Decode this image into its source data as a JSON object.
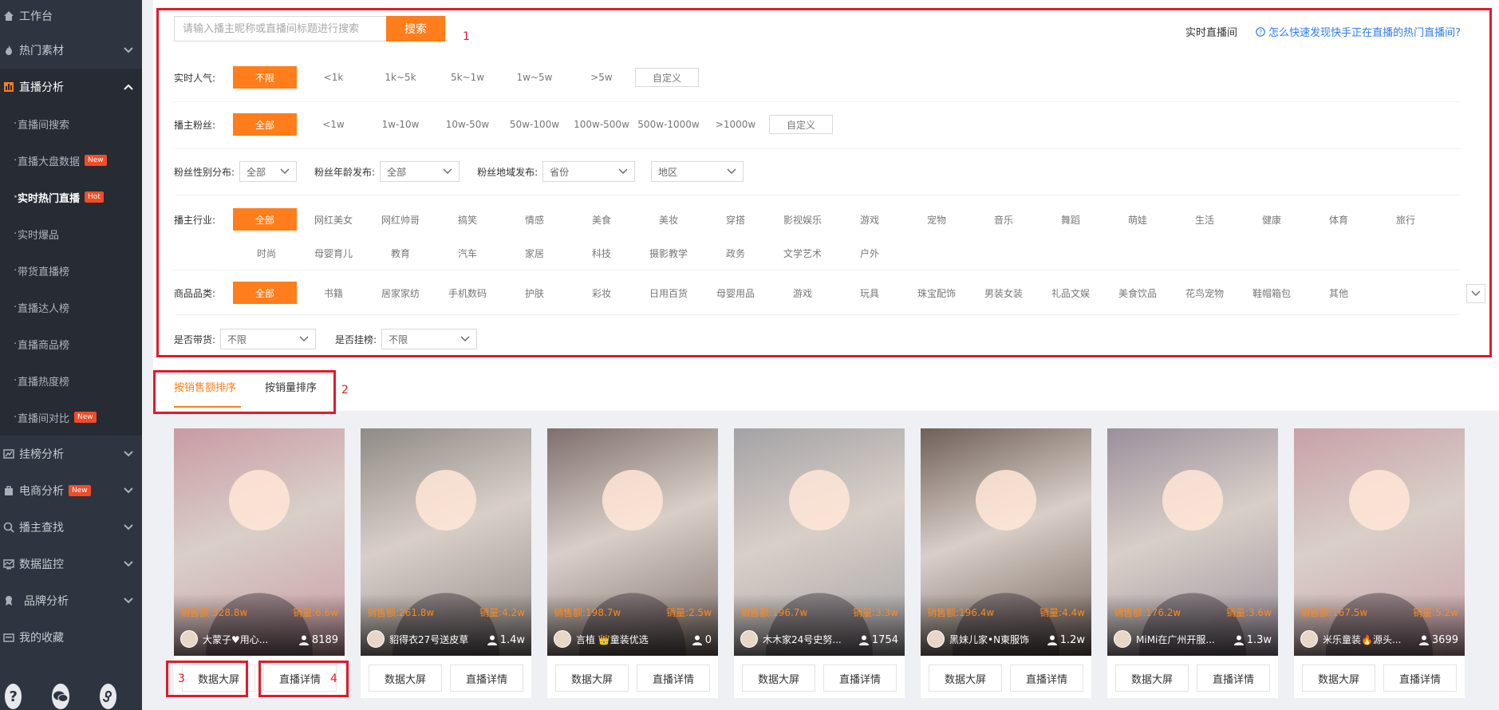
{
  "sidebar": {
    "workbench": "工作台",
    "hot_material": "热门素材",
    "live_analysis": "直播分析",
    "sub_items": [
      {
        "label": "直播间搜索",
        "badge": ""
      },
      {
        "label": "直播大盘数据",
        "badge": "New"
      },
      {
        "label": "实时热门直播",
        "badge": "Hot"
      },
      {
        "label": "实时爆品",
        "badge": ""
      },
      {
        "label": "带货直播榜",
        "badge": ""
      },
      {
        "label": "直播达人榜",
        "badge": ""
      },
      {
        "label": "直播商品榜",
        "badge": ""
      },
      {
        "label": "直播热度榜",
        "badge": ""
      },
      {
        "label": "直播间对比",
        "badge": "New"
      }
    ],
    "groups_after": [
      {
        "label": "挂榜分析",
        "badge": ""
      },
      {
        "label": "电商分析",
        "badge": "New"
      },
      {
        "label": "播主查找",
        "badge": ""
      },
      {
        "label": "数据监控",
        "badge": ""
      },
      {
        "label": "品牌分析",
        "badge": ""
      },
      {
        "label": "我的收藏",
        "badge": ""
      }
    ],
    "accent": "#ff7d1a"
  },
  "search": {
    "placeholder": "请输入播主昵称或直播间标题进行搜索",
    "button": "搜索",
    "realtime_label": "实时直播间",
    "help_link": "怎么快速发现快手正在直播的热门直播间?"
  },
  "filters": {
    "popularity": {
      "label": "实时人气:",
      "options": [
        "不限",
        "<1k",
        "1k~5k",
        "5k~1w",
        "1w~5w",
        ">5w"
      ],
      "custom": "自定义"
    },
    "fans": {
      "label": "播主粉丝:",
      "options": [
        "全部",
        "<1w",
        "1w-10w",
        "10w-50w",
        "50w-100w",
        "100w-500w",
        "500w-1000w",
        ">1000w"
      ],
      "custom": "自定义"
    },
    "gender_label": "粉丝性别分布:",
    "gender_value": "全部",
    "age_label": "粉丝年龄发布:",
    "age_value": "全部",
    "region_label": "粉丝地域发布:",
    "province_value": "省份",
    "district_value": "地区",
    "industry": {
      "label": "播主行业:",
      "row1": [
        "全部",
        "网红美女",
        "网红帅哥",
        "搞笑",
        "情感",
        "美食",
        "美妆",
        "穿搭",
        "影视娱乐",
        "游戏",
        "宠物",
        "音乐",
        "舞蹈",
        "萌娃",
        "生活",
        "健康",
        "体育",
        "旅行"
      ],
      "row2": [
        "时尚",
        "母婴育儿",
        "教育",
        "汽车",
        "家居",
        "科技",
        "摄影教学",
        "政务",
        "文学艺术",
        "户外"
      ]
    },
    "category": {
      "label": "商品品类:",
      "options": [
        "全部",
        "书籍",
        "居家家纺",
        "手机数码",
        "护肤",
        "彩妆",
        "日用百货",
        "母婴用品",
        "游戏",
        "玩具",
        "珠宝配饰",
        "男装女装",
        "礼品文娱",
        "美食饮品",
        "花鸟宠物",
        "鞋帽箱包",
        "其他"
      ]
    },
    "selling_label": "是否带货:",
    "selling_value": "不限",
    "ranked_label": "是否挂榜:",
    "ranked_value": "不限"
  },
  "tabs": [
    "按销售额排序",
    "按销量排序"
  ],
  "annotations": [
    "1",
    "2",
    "3",
    "4"
  ],
  "cards": [
    {
      "sales": "销售额:328.8w",
      "volume": "销量:6.6w",
      "anchor": "大蒙子♥用心...",
      "viewers": "8189",
      "bg": "#c99aa4"
    },
    {
      "sales": "销售额:261.8w",
      "volume": "销量:4.2w",
      "anchor": "貂得衣27号送皮草",
      "viewers": "1.4w",
      "bg": "#8f8a86"
    },
    {
      "sales": "销售额:198.7w",
      "volume": "销量:2.5w",
      "anchor": "言植 👑童装优选",
      "viewers": "0",
      "bg": "#7e6f6a"
    },
    {
      "sales": "销售额:196.7w",
      "volume": "销量:3.3w",
      "anchor": "木木家24号史努...",
      "viewers": "1754",
      "bg": "#a3a2a5"
    },
    {
      "sales": "销售额:196.4w",
      "volume": "销量:4.4w",
      "anchor": "黑妹儿家•N東服饰",
      "viewers": "1.2w",
      "bg": "#6f6058"
    },
    {
      "sales": "销售额:176.2w",
      "volume": "销量:3.6w",
      "anchor": "MiMi在广州开服...",
      "viewers": "1.3w",
      "bg": "#9a8f9c"
    },
    {
      "sales": "销售额:167.5w",
      "volume": "销量:5.2w",
      "anchor": "米乐童装🔥源头...",
      "viewers": "3699",
      "bg": "#c8a0a8"
    }
  ],
  "card_buttons": {
    "screen": "数据大屏",
    "detail": "直播详情"
  }
}
